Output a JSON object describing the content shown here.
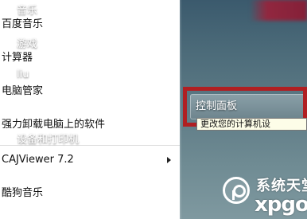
{
  "left_panel": {
    "items": [
      {
        "label": "百度音乐"
      },
      {
        "label": "计算器"
      },
      {
        "label": "电脑管家"
      },
      {
        "label": "强力卸载电脑上的软件"
      },
      {
        "label": "CAJViewer 7.2"
      },
      {
        "label": "酷狗音乐"
      }
    ]
  },
  "right_panel": {
    "items": [
      {
        "label": "音乐"
      },
      {
        "label": "游戏"
      },
      {
        "label": "liu"
      },
      {
        "label": "控制面板"
      },
      {
        "label": "设备和打印机"
      }
    ],
    "tooltip": "更改您的计算机设"
  },
  "watermark": {
    "cn": "系统天堂",
    "en": "xpgod"
  },
  "colors": {
    "highlight_border": "#b01f22",
    "right_bg_top": "#3b5a6d",
    "right_bg_bottom": "#7f99a0"
  }
}
